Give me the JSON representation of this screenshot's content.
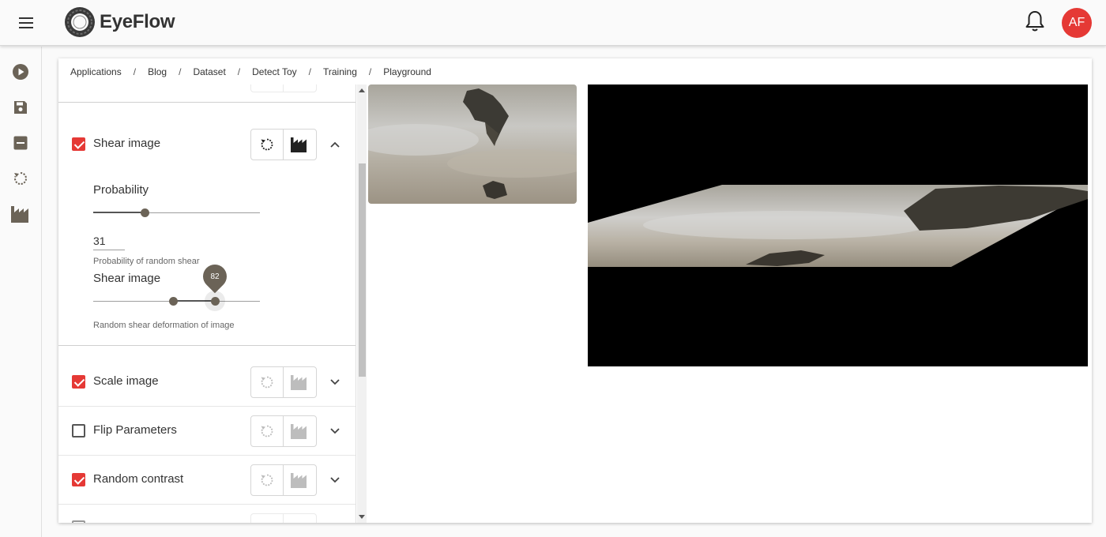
{
  "app": {
    "name": "EyeFlow",
    "user_initials": "AF",
    "accent_color": "#e53935"
  },
  "breadcrumb": [
    "Applications",
    "Blog",
    "Dataset",
    "Detect Toy",
    "Training",
    "Playground"
  ],
  "breadcrumb_separator": "/",
  "rail_icons": [
    "play-icon",
    "save-icon",
    "remove-icon",
    "reset-icon",
    "factory-icon"
  ],
  "augmentations": [
    {
      "label": "Shear image",
      "checked": true,
      "expanded": true,
      "controls": {
        "probability_label": "Probability",
        "probability_value": "31",
        "probability_fraction": 0.31,
        "probability_hint": "Probability of random shear",
        "shear_label": "Shear image",
        "shear_bubble_value": "82",
        "shear_range_fraction": [
          0.48,
          0.73
        ],
        "shear_hint": "Random shear deformation of image"
      }
    },
    {
      "label": "Scale image",
      "checked": true,
      "expanded": false
    },
    {
      "label": "Flip Parameters",
      "checked": false,
      "expanded": false
    },
    {
      "label": "Random contrast",
      "checked": true,
      "expanded": false
    }
  ]
}
